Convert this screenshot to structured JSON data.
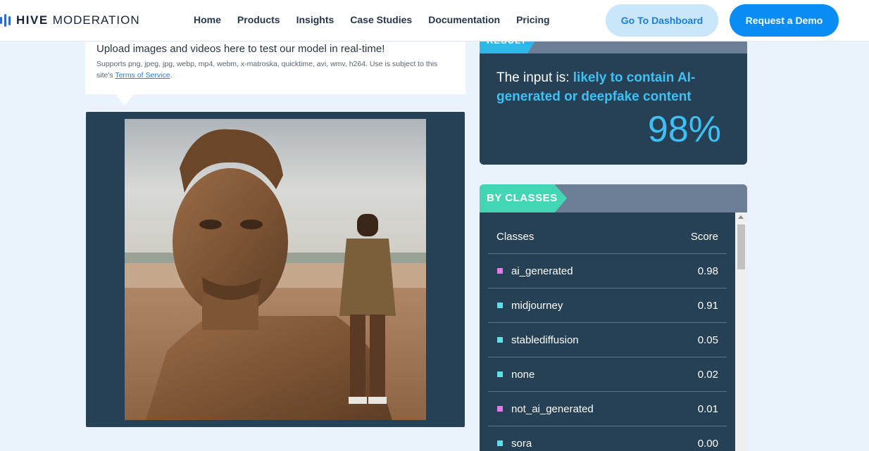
{
  "header": {
    "logo": {
      "primary": "HIVE",
      "secondary": "MODERATION"
    },
    "nav": [
      {
        "label": "Home"
      },
      {
        "label": "Products"
      },
      {
        "label": "Insights"
      },
      {
        "label": "Case Studies"
      },
      {
        "label": "Documentation"
      },
      {
        "label": "Pricing"
      }
    ],
    "dashboard_label": "Go To Dashboard",
    "demo_label": "Request a Demo"
  },
  "upload": {
    "title": "Upload images and videos here to test our model in real-time!",
    "supports": "Supports png, jpeg, jpg, webp, mp4, webm, x-matroska, quicktime, avi, wmv, h264. Use is subject to this site's",
    "terms_link": "Terms of Service",
    "terms_suffix": "."
  },
  "result": {
    "tag": "RESULT",
    "prefix": "The input is: ",
    "verdict": "likely to contain AI-generated or deepfake content",
    "percent": "98%"
  },
  "classes": {
    "tag": "BY CLASSES",
    "col_class": "Classes",
    "col_score": "Score",
    "rows": [
      {
        "name": "ai_generated",
        "score": "0.98",
        "color": "#e37ae8"
      },
      {
        "name": "midjourney",
        "score": "0.91",
        "color": "#5fe0e8"
      },
      {
        "name": "stablediffusion",
        "score": "0.05",
        "color": "#5fe0e8"
      },
      {
        "name": "none",
        "score": "0.02",
        "color": "#5fe0e8"
      },
      {
        "name": "not_ai_generated",
        "score": "0.01",
        "color": "#e37ae8"
      },
      {
        "name": "sora",
        "score": "0.00",
        "color": "#5fe0e8"
      }
    ]
  },
  "colors": {
    "accent": "#0a8cf5",
    "panel": "#264055",
    "highlight": "#3fc0f4",
    "classes_tag": "#43d6b4"
  }
}
